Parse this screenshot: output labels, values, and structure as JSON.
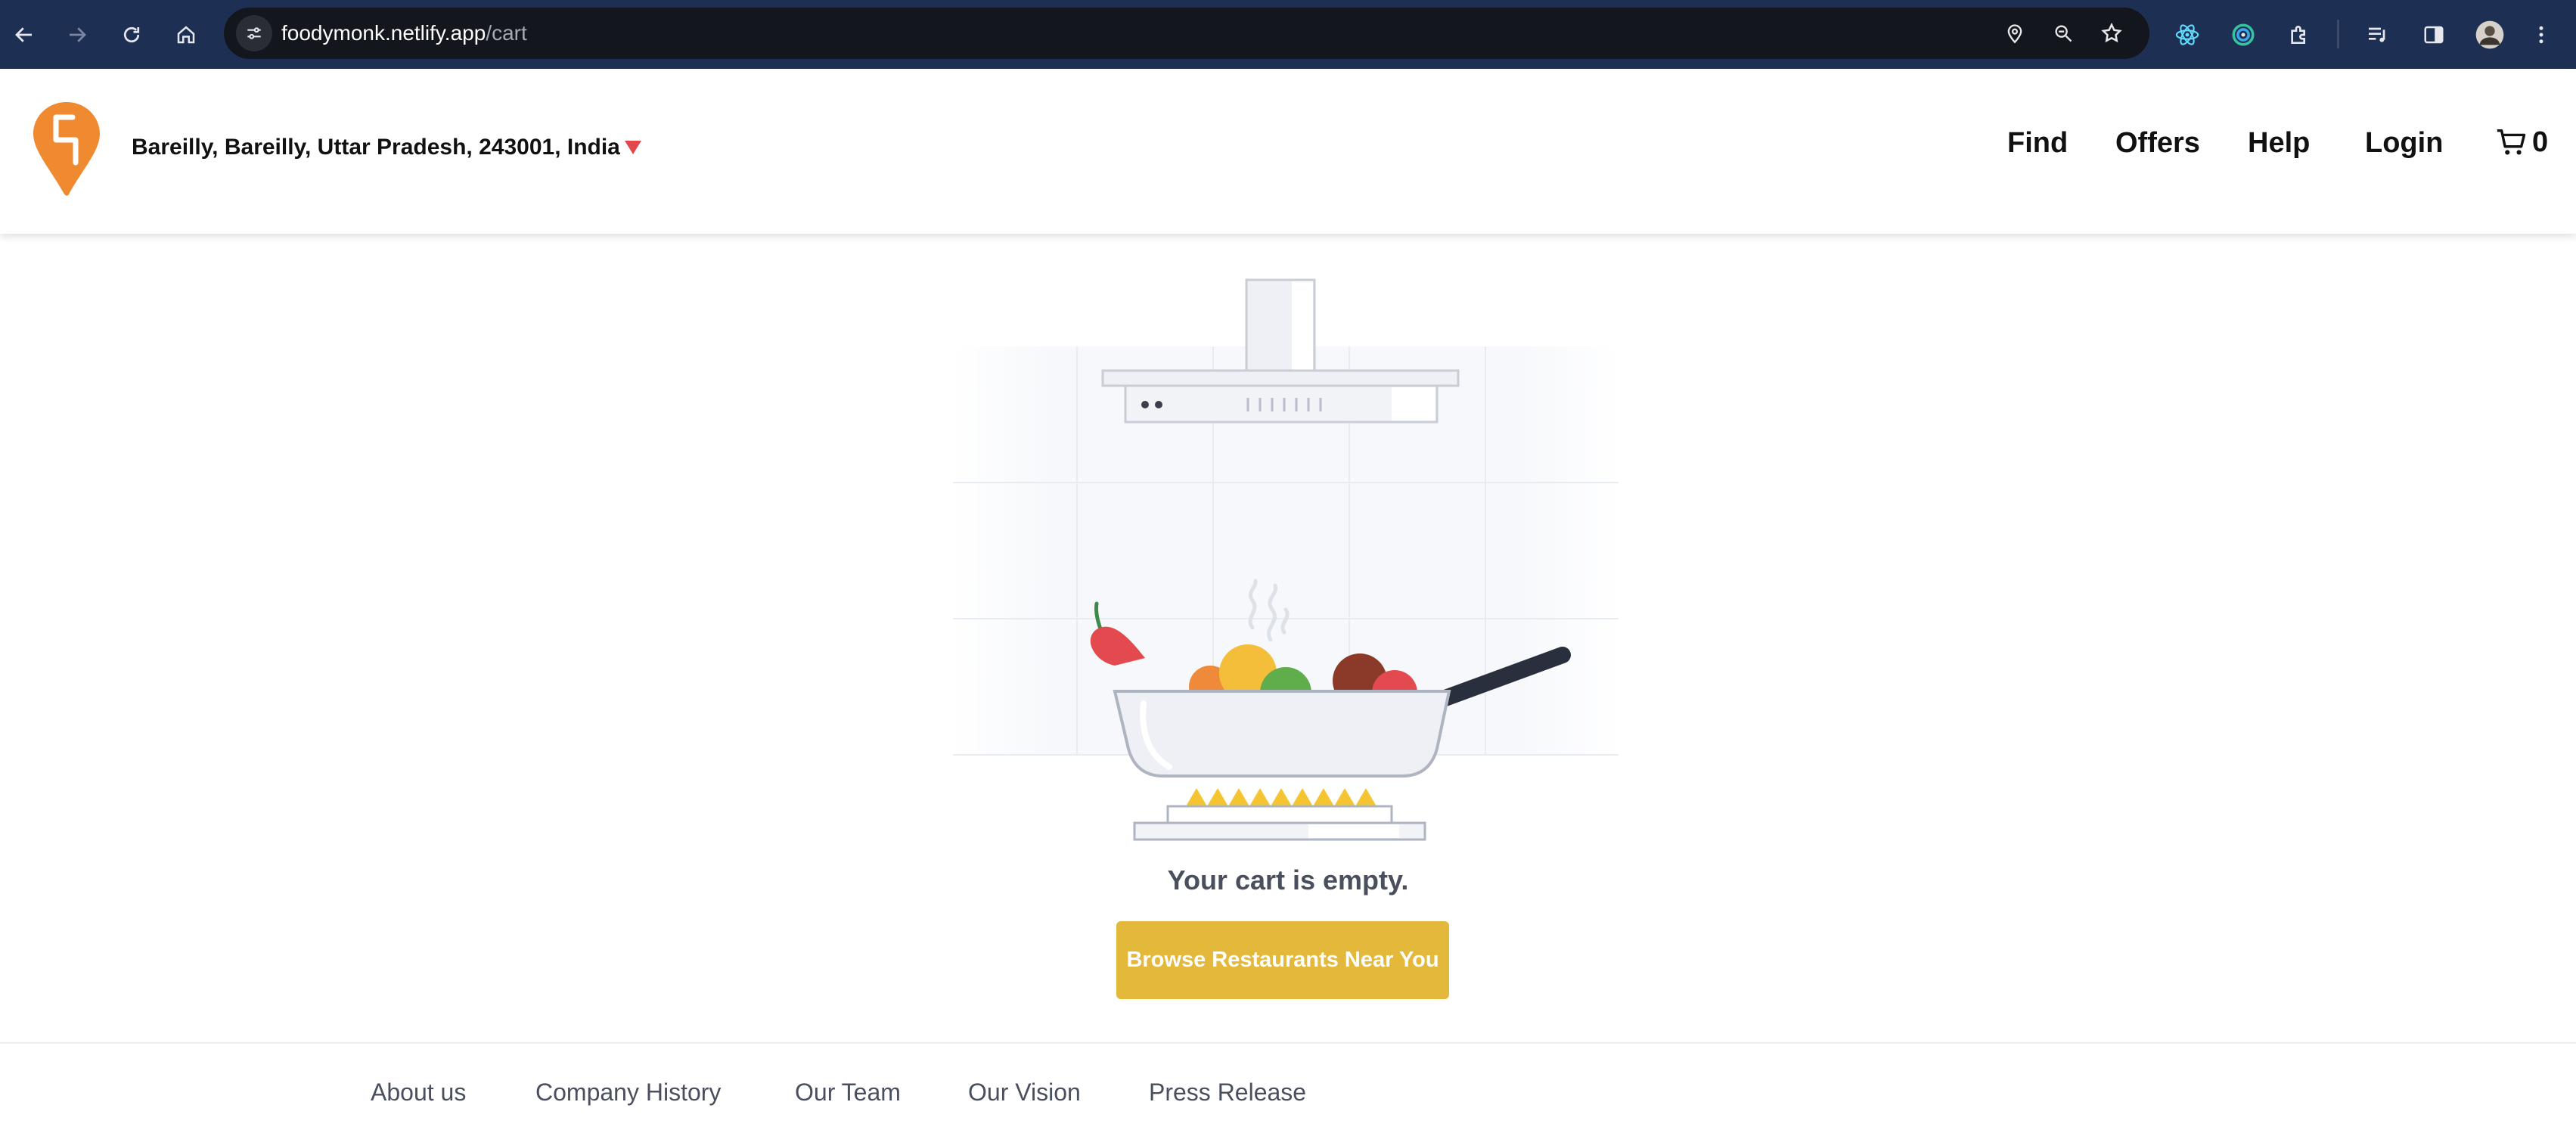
{
  "browser": {
    "url_host": "foodymonk.netlify.app",
    "url_path": "/cart",
    "icons": [
      "back-icon",
      "forward-icon",
      "reload-icon",
      "home-icon",
      "site-settings-icon",
      "location-icon",
      "zoom-icon",
      "bookmark-star-icon",
      "react-devtools-icon",
      "extension-icon",
      "puzzle-extensions-icon",
      "media-controls-icon",
      "side-panel-icon",
      "profile-avatar",
      "more-menu-icon"
    ]
  },
  "header": {
    "location": "Bareilly, Bareilly, Uttar Pradesh, 243001, India",
    "nav": [
      "Find",
      "Offers",
      "Help",
      "Login"
    ],
    "cart_count": "0",
    "brand_color": "#f08a31"
  },
  "main": {
    "empty_message": "Your cart is empty.",
    "browse_button": "Browse Restaurants Near You",
    "button_color": "#e3b83b"
  },
  "footer": {
    "links": [
      "About us",
      "Company History",
      "Our Team",
      "Our Vision",
      "Press Release"
    ]
  }
}
